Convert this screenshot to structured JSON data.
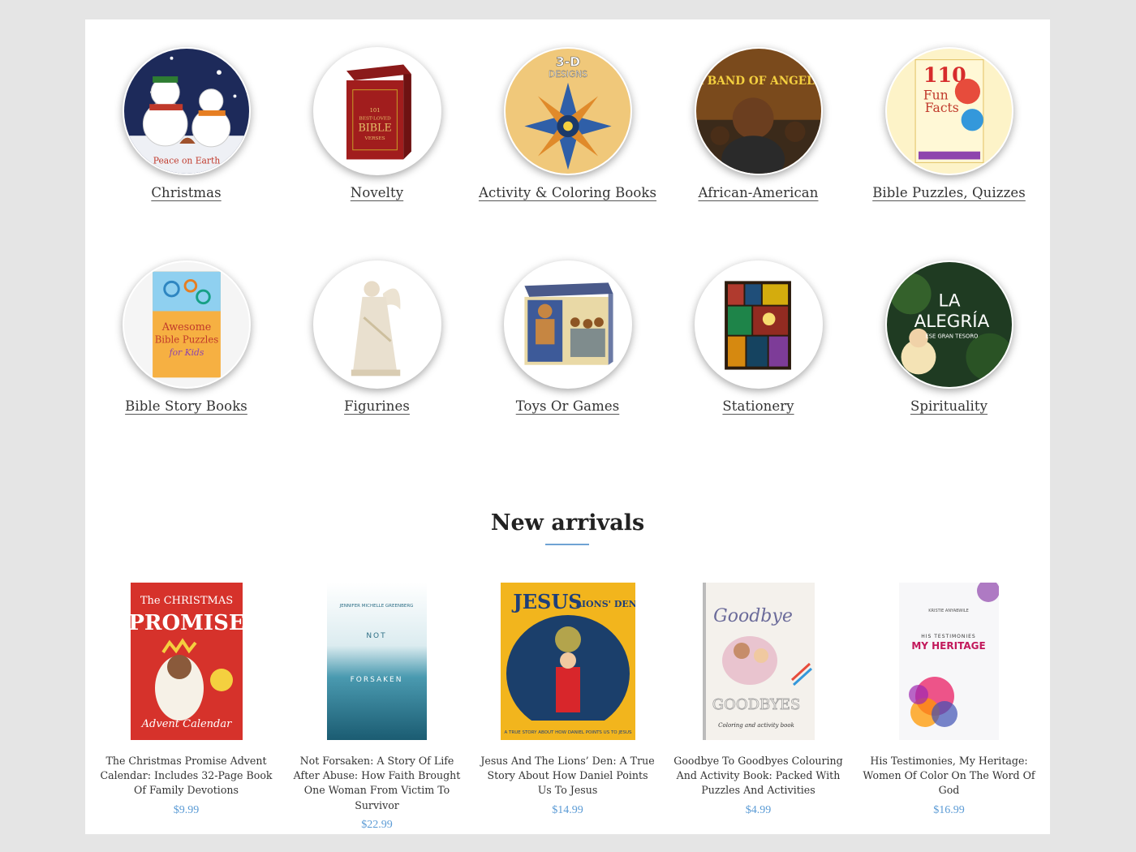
{
  "categories": [
    {
      "label": "Christmas"
    },
    {
      "label": "Novelty"
    },
    {
      "label": "Activity & Coloring Books"
    },
    {
      "label": "African-American"
    },
    {
      "label": "Bible Puzzles, Quizzes"
    },
    {
      "label": "Bible Story Books"
    },
    {
      "label": "Figurines"
    },
    {
      "label": "Toys Or Games"
    },
    {
      "label": "Stationery"
    },
    {
      "label": "Spirituality"
    }
  ],
  "category_image_text": {
    "christmas": "Peace on Earth",
    "novelty_line1": "101",
    "novelty_line2": "BEST-LOVED",
    "novelty_line3": "BIBLE",
    "novelty_line4": "VERSES",
    "activity_line1": "3-D",
    "activity_line2": "DESIGNS",
    "african": "A BAND OF ANGELS",
    "puzzles_line1": "110",
    "puzzles_line2": "Fun",
    "puzzles_line3": "Facts",
    "bible_story_line1": "Awesome",
    "bible_story_line2": "Bible Puzzles",
    "bible_story_line3": "for Kids",
    "spirit_line1": "LA",
    "spirit_line2": "ALEGRÍA",
    "spirit_line3": "ESE GRAN TESORO"
  },
  "new_arrivals": {
    "title": "New arrivals",
    "products": [
      {
        "title": "The Christmas Promise Advent Calendar: Includes 32-Page Book Of Family Devotions",
        "price": "$9.99",
        "cover_text": {
          "t1": "The CHRISTMAS",
          "t2": "PROMISE",
          "t3": "Advent Calendar"
        }
      },
      {
        "title": "Not Forsaken: A Story Of Life After Abuse: How Faith Brought One Woman From Victim To Survivor",
        "price": "$22.99",
        "cover_text": {
          "t1": "JENNIFER MICHELLE GREENBERG",
          "t2": "NOT",
          "t3": "FORSAKEN"
        }
      },
      {
        "title": "Jesus And The Lions’ Den: A True Story About How Daniel Points Us To Jesus",
        "price": "$14.99",
        "cover_text": {
          "t1": "JESUS",
          "t2": "LIONS' DEN",
          "t3": "A TRUE STORY ABOUT HOW DANIEL POINTS US TO JESUS"
        }
      },
      {
        "title": "Goodbye To Goodbyes Colouring And Activity Book: Packed With Puzzles And Activities",
        "price": "$4.99",
        "cover_text": {
          "t1": "Goodbye",
          "t2": "GOODBYES",
          "t3": "Coloring and activity book"
        }
      },
      {
        "title": "His Testimonies, My Heritage: Women Of Color On The Word Of God",
        "price": "$16.99",
        "cover_text": {
          "t1": "HIS TESTIMONIES",
          "t2": "MY HERITAGE",
          "t3": "KRISTIE ANYABWILE"
        }
      }
    ]
  }
}
